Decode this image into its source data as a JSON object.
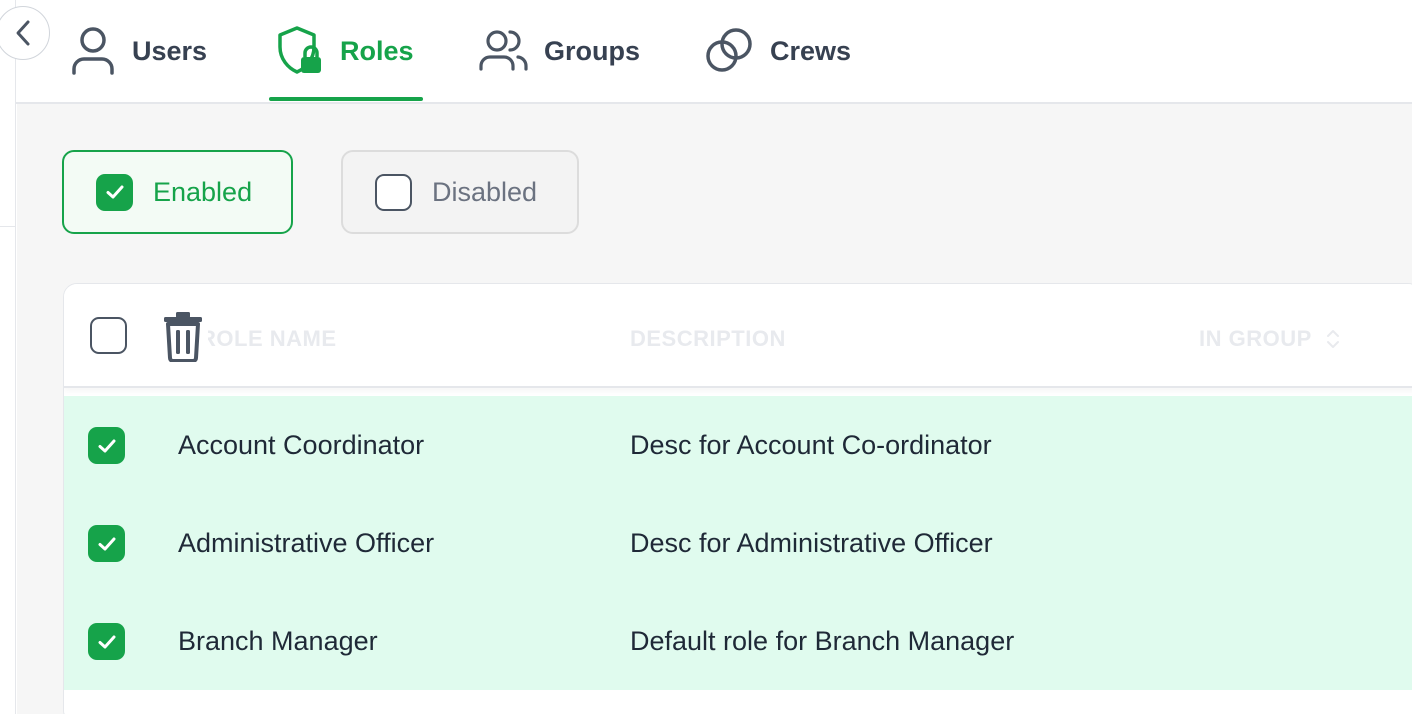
{
  "tabs": [
    {
      "label": "Users",
      "icon": "user-icon",
      "active": false
    },
    {
      "label": "Roles",
      "icon": "shield-lock-icon",
      "active": true
    },
    {
      "label": "Groups",
      "icon": "users-group-icon",
      "active": false
    },
    {
      "label": "Crews",
      "icon": "overlapping-circles-icon",
      "active": false
    }
  ],
  "filters": {
    "enabled_label": "Enabled",
    "enabled_checked": true,
    "disabled_label": "Disabled",
    "disabled_checked": false
  },
  "table": {
    "headers": {
      "name": "ROLE NAME",
      "description": "DESCRIPTION",
      "in_group": "IN GROUP"
    },
    "rows": [
      {
        "name": "Account Coordinator",
        "description": "Desc for Account Co-ordinator",
        "checked": true
      },
      {
        "name": "Administrative Officer",
        "description": "Desc for Administrative Officer",
        "checked": true
      },
      {
        "name": "Branch Manager",
        "description": "Default role for Branch Manager",
        "checked": true
      }
    ]
  },
  "colors": {
    "accent": "#16a34a",
    "selected_row": "#e0fbee",
    "content_bg": "#f6f6f6",
    "tab_text": "#374151"
  }
}
